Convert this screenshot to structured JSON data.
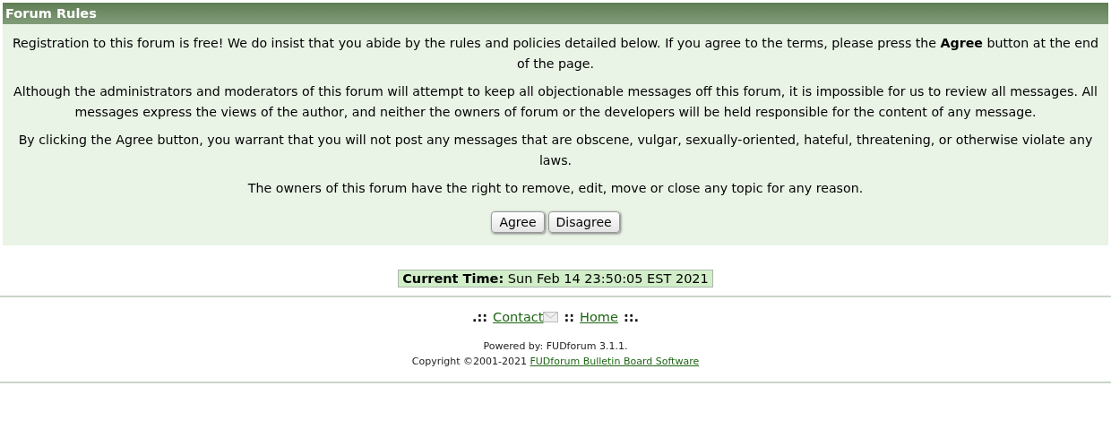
{
  "header": {
    "title": "Forum Rules"
  },
  "paragraphs": [
    "Registration to this forum is free! We do insist that you abide by the rules and policies detailed below. If you agree to the terms, please press the **Agree** button at the end of the page.",
    "Although the administrators and moderators of this forum will attempt to keep all objectionable messages off this forum, it is impossible for us to review all messages. All messages express the views of the author, and neither the owners of forum or the developers will be held responsible for the content of any message.",
    "By clicking the Agree button, you warrant that you will not post any messages that are obscene, vulgar, sexually-oriented, hateful, threatening, or otherwise violate any laws.",
    "The owners of this forum have the right to remove, edit, move or close any topic for any reason."
  ],
  "buttons": [
    "Agree",
    "Disagree"
  ],
  "current_time": {
    "label": "Current Time:",
    "value": "Sun Feb 14 23:50:05 EST 2021"
  },
  "footer_nav": {
    "start": ".::",
    "middle": "::",
    "end": "::.",
    "links": [
      {
        "label": "Contact",
        "kind": "mail"
      },
      {
        "label": "Home",
        "kind": "plain"
      }
    ]
  },
  "powered_by": "Powered by: FUDforum 3.1.1.",
  "copyright": {
    "text": "Copyright ©2001-2021",
    "link": "FUDforum Bulletin Board Software"
  }
}
